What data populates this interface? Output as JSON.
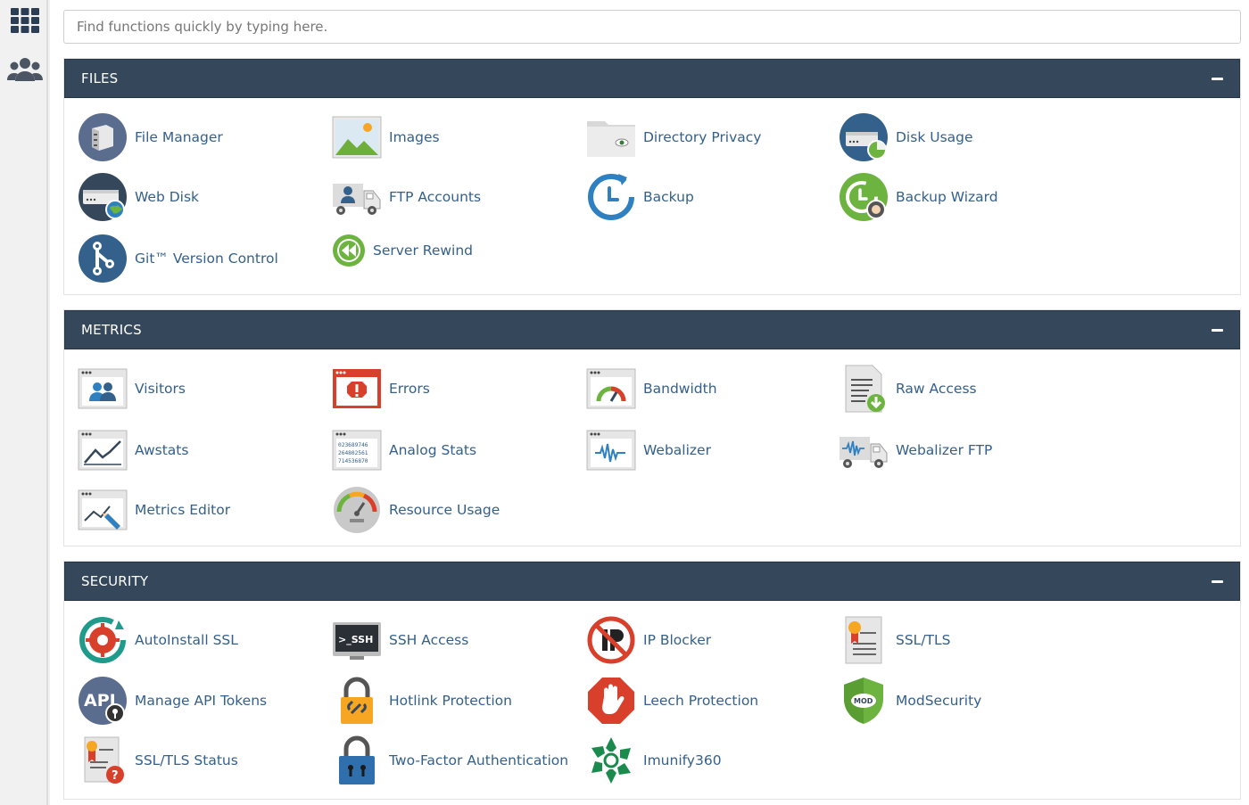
{
  "search": {
    "placeholder": "Find functions quickly by typing here."
  },
  "colors": {
    "header": "#34475b",
    "link": "#34608c",
    "accent_blue": "#2f80c1",
    "accent_green": "#6db33f"
  },
  "sidebar": [
    {
      "icon": "apps-grid-icon"
    },
    {
      "icon": "users-icon"
    }
  ],
  "groups": {
    "files": {
      "title": "FILES",
      "items": [
        {
          "label": "File Manager",
          "icon": "file-manager-icon"
        },
        {
          "label": "Images",
          "icon": "images-icon"
        },
        {
          "label": "Directory Privacy",
          "icon": "directory-privacy-icon"
        },
        {
          "label": "Disk Usage",
          "icon": "disk-usage-icon"
        },
        {
          "label": "Web Disk",
          "icon": "web-disk-icon"
        },
        {
          "label": "FTP Accounts",
          "icon": "ftp-accounts-icon"
        },
        {
          "label": "Backup",
          "icon": "backup-icon"
        },
        {
          "label": "Backup Wizard",
          "icon": "backup-wizard-icon"
        },
        {
          "label": "Git™ Version Control",
          "icon": "git-icon"
        },
        {
          "label": "Server Rewind",
          "icon": "server-rewind-icon"
        }
      ]
    },
    "metrics": {
      "title": "METRICS",
      "items": [
        {
          "label": "Visitors",
          "icon": "visitors-icon"
        },
        {
          "label": "Errors",
          "icon": "errors-icon"
        },
        {
          "label": "Bandwidth",
          "icon": "bandwidth-icon"
        },
        {
          "label": "Raw Access",
          "icon": "raw-access-icon"
        },
        {
          "label": "Awstats",
          "icon": "awstats-icon"
        },
        {
          "label": "Analog Stats",
          "icon": "analog-stats-icon",
          "icon_text": [
            "023689746",
            "264802561",
            "714536870"
          ]
        },
        {
          "label": "Webalizer",
          "icon": "webalizer-icon"
        },
        {
          "label": "Webalizer FTP",
          "icon": "webalizer-ftp-icon"
        },
        {
          "label": "Metrics Editor",
          "icon": "metrics-editor-icon"
        },
        {
          "label": "Resource Usage",
          "icon": "resource-usage-icon"
        }
      ]
    },
    "security": {
      "title": "SECURITY",
      "items": [
        {
          "label": "AutoInstall SSL",
          "icon": "autoinstall-ssl-icon"
        },
        {
          "label": "SSH Access",
          "icon": "ssh-access-icon",
          "icon_text": ">_SSH"
        },
        {
          "label": "IP Blocker",
          "icon": "ip-blocker-icon"
        },
        {
          "label": "SSL/TLS",
          "icon": "ssl-tls-icon"
        },
        {
          "label": "Manage API Tokens",
          "icon": "api-tokens-icon",
          "icon_text": "API"
        },
        {
          "label": "Hotlink Protection",
          "icon": "hotlink-protection-icon"
        },
        {
          "label": "Leech Protection",
          "icon": "leech-protection-icon"
        },
        {
          "label": "ModSecurity",
          "icon": "modsecurity-icon",
          "icon_text": "MOD"
        },
        {
          "label": "SSL/TLS Status",
          "icon": "ssl-tls-status-icon"
        },
        {
          "label": "Two-Factor Authentication",
          "icon": "two-factor-icon"
        },
        {
          "label": "Imunify360",
          "icon": "imunify360-icon"
        }
      ]
    }
  }
}
